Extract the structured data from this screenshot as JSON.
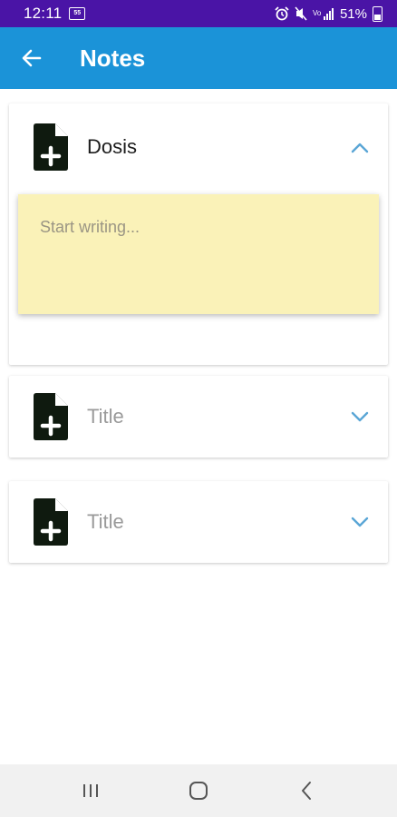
{
  "status_bar": {
    "time": "12:11",
    "notification_badge": "55",
    "battery_percent": "51%"
  },
  "app_bar": {
    "title": "Notes",
    "back_icon": "arrow-left-icon"
  },
  "notes": [
    {
      "title": "Dosis",
      "title_is_placeholder": false,
      "expanded": true,
      "body_placeholder": "Start writing...",
      "icon": "note-add-icon"
    },
    {
      "title": "Title",
      "title_is_placeholder": true,
      "expanded": false,
      "icon": "note-add-icon"
    },
    {
      "title": "Title",
      "title_is_placeholder": true,
      "expanded": false,
      "icon": "note-add-icon"
    }
  ],
  "colors": {
    "status_bar": "#4a14a6",
    "app_bar": "#1b93d8",
    "note_body": "#faf2b8",
    "icon": "#0f1a0f",
    "chevron": "#5aa6d6"
  }
}
